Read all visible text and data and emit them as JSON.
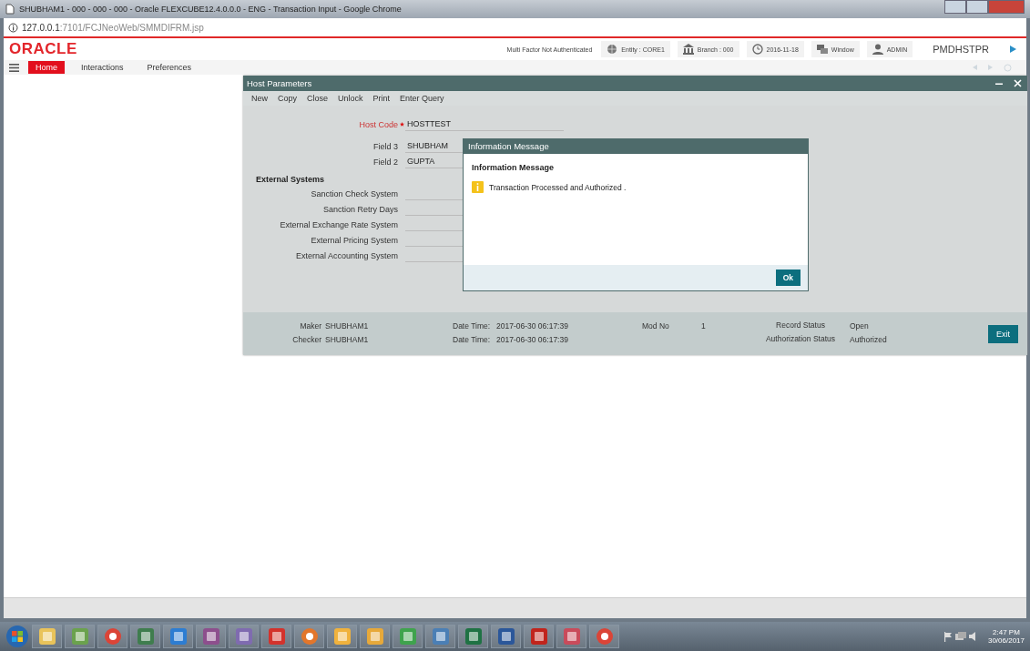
{
  "browser": {
    "title": "SHUBHAM1 - 000 - 000 - 000 - Oracle FLEXCUBE12.4.0.0.0 - ENG - Transaction Input - Google Chrome",
    "address_host": "127.0.0.1",
    "address_path": ":7101/FCJNeoWeb/SMMDIFRM.jsp"
  },
  "header": {
    "logo": "ORACLE",
    "auth_status": "Multi Factor Not Authenticated",
    "chips": [
      {
        "kind": "globe",
        "label": "Entity : CORE1"
      },
      {
        "kind": "bank",
        "label": "Branch : 000"
      },
      {
        "kind": "clock",
        "label": "2016-11-18"
      },
      {
        "kind": "window",
        "label": "Window"
      },
      {
        "kind": "user",
        "label": "ADMIN"
      }
    ],
    "function_id": "PMDHSTPR"
  },
  "menu": [
    {
      "label": "Home",
      "selected": true
    },
    {
      "label": "Interactions",
      "selected": false
    },
    {
      "label": "Preferences",
      "selected": false
    }
  ],
  "form_window": {
    "title": "Host Parameters",
    "toolbar": [
      "New",
      "Copy",
      "Close",
      "Unlock",
      "Print",
      "Enter Query"
    ],
    "fields": [
      {
        "label": "Host Code",
        "required": true,
        "value": "HOSTTEST",
        "kind": "field"
      },
      {
        "label": "Field 3",
        "required": false,
        "value": "SHUBHAM",
        "kind": "field"
      },
      {
        "label": "Field 2",
        "required": false,
        "value": "GUPTA",
        "kind": "field"
      },
      {
        "label": "External Systems",
        "kind": "section"
      },
      {
        "label": "Sanction Check System",
        "required": false,
        "kind": "field"
      },
      {
        "label": "Sanction Retry Days",
        "required": false,
        "kind": "field"
      },
      {
        "label": "External Exchange Rate System",
        "required": false,
        "kind": "field"
      },
      {
        "label": "External Pricing System",
        "required": false,
        "kind": "field"
      },
      {
        "label": "External Accounting System",
        "required": false,
        "kind": "field"
      }
    ],
    "audit": [
      {
        "user_label": "Maker",
        "user": "SHUBHAM1",
        "time_label": "Date Time:",
        "time": "2017-06-30 06:17:39",
        "mod_label": "Mod No",
        "mod": "1",
        "status_label": "Record Status",
        "status": "Open"
      },
      {
        "user_label": "Checker",
        "user": "SHUBHAM1",
        "time_label": "Date Time:",
        "time": "2017-06-30 06:17:39",
        "status_label": "Authorization Status",
        "status": "Authorized"
      }
    ],
    "exit_button": "Exit"
  },
  "dialog": {
    "title": "Information Message",
    "heading": "Information Message",
    "message": "Transaction Processed and Authorized .",
    "ok_button": "Ok"
  },
  "tray": {
    "time": "2:47 PM",
    "date": "30/06/2017"
  }
}
